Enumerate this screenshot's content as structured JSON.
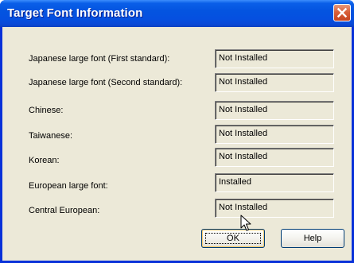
{
  "window": {
    "title": "Target Font Information"
  },
  "rows": [
    {
      "label": "Japanese large font (First standard):",
      "status": "Not Installed"
    },
    {
      "label": "Japanese large font (Second standard):",
      "status": "Not Installed"
    },
    {
      "label": "Chinese:",
      "status": "Not Installed"
    },
    {
      "label": "Taiwanese:",
      "status": "Not Installed"
    },
    {
      "label": "Korean:",
      "status": "Not Installed"
    },
    {
      "label": "European large font:",
      "status": "Installed"
    },
    {
      "label": "Central European:",
      "status": "Not Installed"
    }
  ],
  "buttons": {
    "ok": "OK",
    "help": "Help"
  },
  "icons": {
    "close": "close-icon",
    "cursor": "mouse-pointer-icon"
  },
  "colors": {
    "titlebar": "#0454e0",
    "close_button": "#d9603a",
    "dialog_background": "#ece9d8"
  }
}
